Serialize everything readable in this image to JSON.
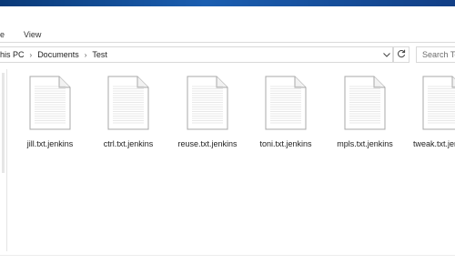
{
  "ribbon": {
    "tabs": [
      "e",
      "View"
    ]
  },
  "address_bar": {
    "crumbs": [
      "his PC",
      "Documents",
      "Test"
    ],
    "separator": "›"
  },
  "search": {
    "placeholder": "Search Te"
  },
  "files": [
    {
      "name": "jill.txt.jenkins"
    },
    {
      "name": "ctrl.txt.jenkins"
    },
    {
      "name": "reuse.txt.jenkins"
    },
    {
      "name": "toni.txt.jenkins"
    },
    {
      "name": "mpls.txt.jenkins"
    },
    {
      "name": "tweak.txt.jenkins"
    }
  ],
  "colors": {
    "title_bar": "#1b5eb0",
    "icon_stroke": "#a8a8a8",
    "icon_lines": "#d2d2d2"
  }
}
